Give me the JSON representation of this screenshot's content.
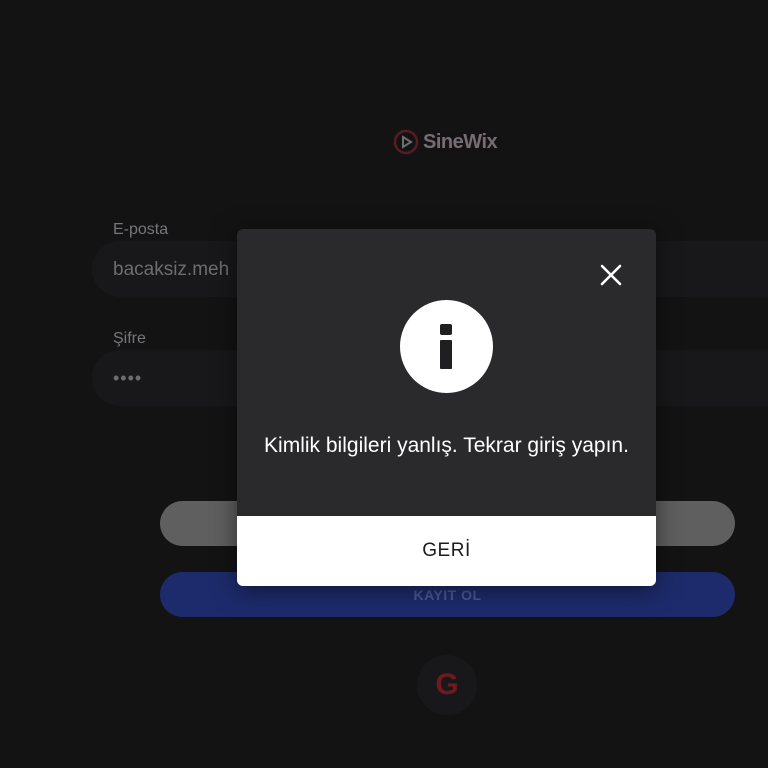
{
  "app": {
    "brand": "SineWix",
    "logo_icon": "play-circle-icon"
  },
  "login_form": {
    "email_label": "E-posta",
    "email_value": "bacaksiz.meh",
    "password_label": "Şifre",
    "password_value": "••••",
    "register_button_label": "KAYIT OL",
    "google_icon": "google-icon",
    "google_glyph": "G"
  },
  "dialog": {
    "icon": "info-icon",
    "close_icon": "close-icon",
    "message": "Kimlik bilgileri yanlış. Tekrar giriş yapın.",
    "action_label": "GERİ"
  },
  "colors": {
    "background": "#131314",
    "dialog_background": "#2a2a2c",
    "register_button": "#1d2b6c",
    "login_button": "#5f5f60"
  }
}
